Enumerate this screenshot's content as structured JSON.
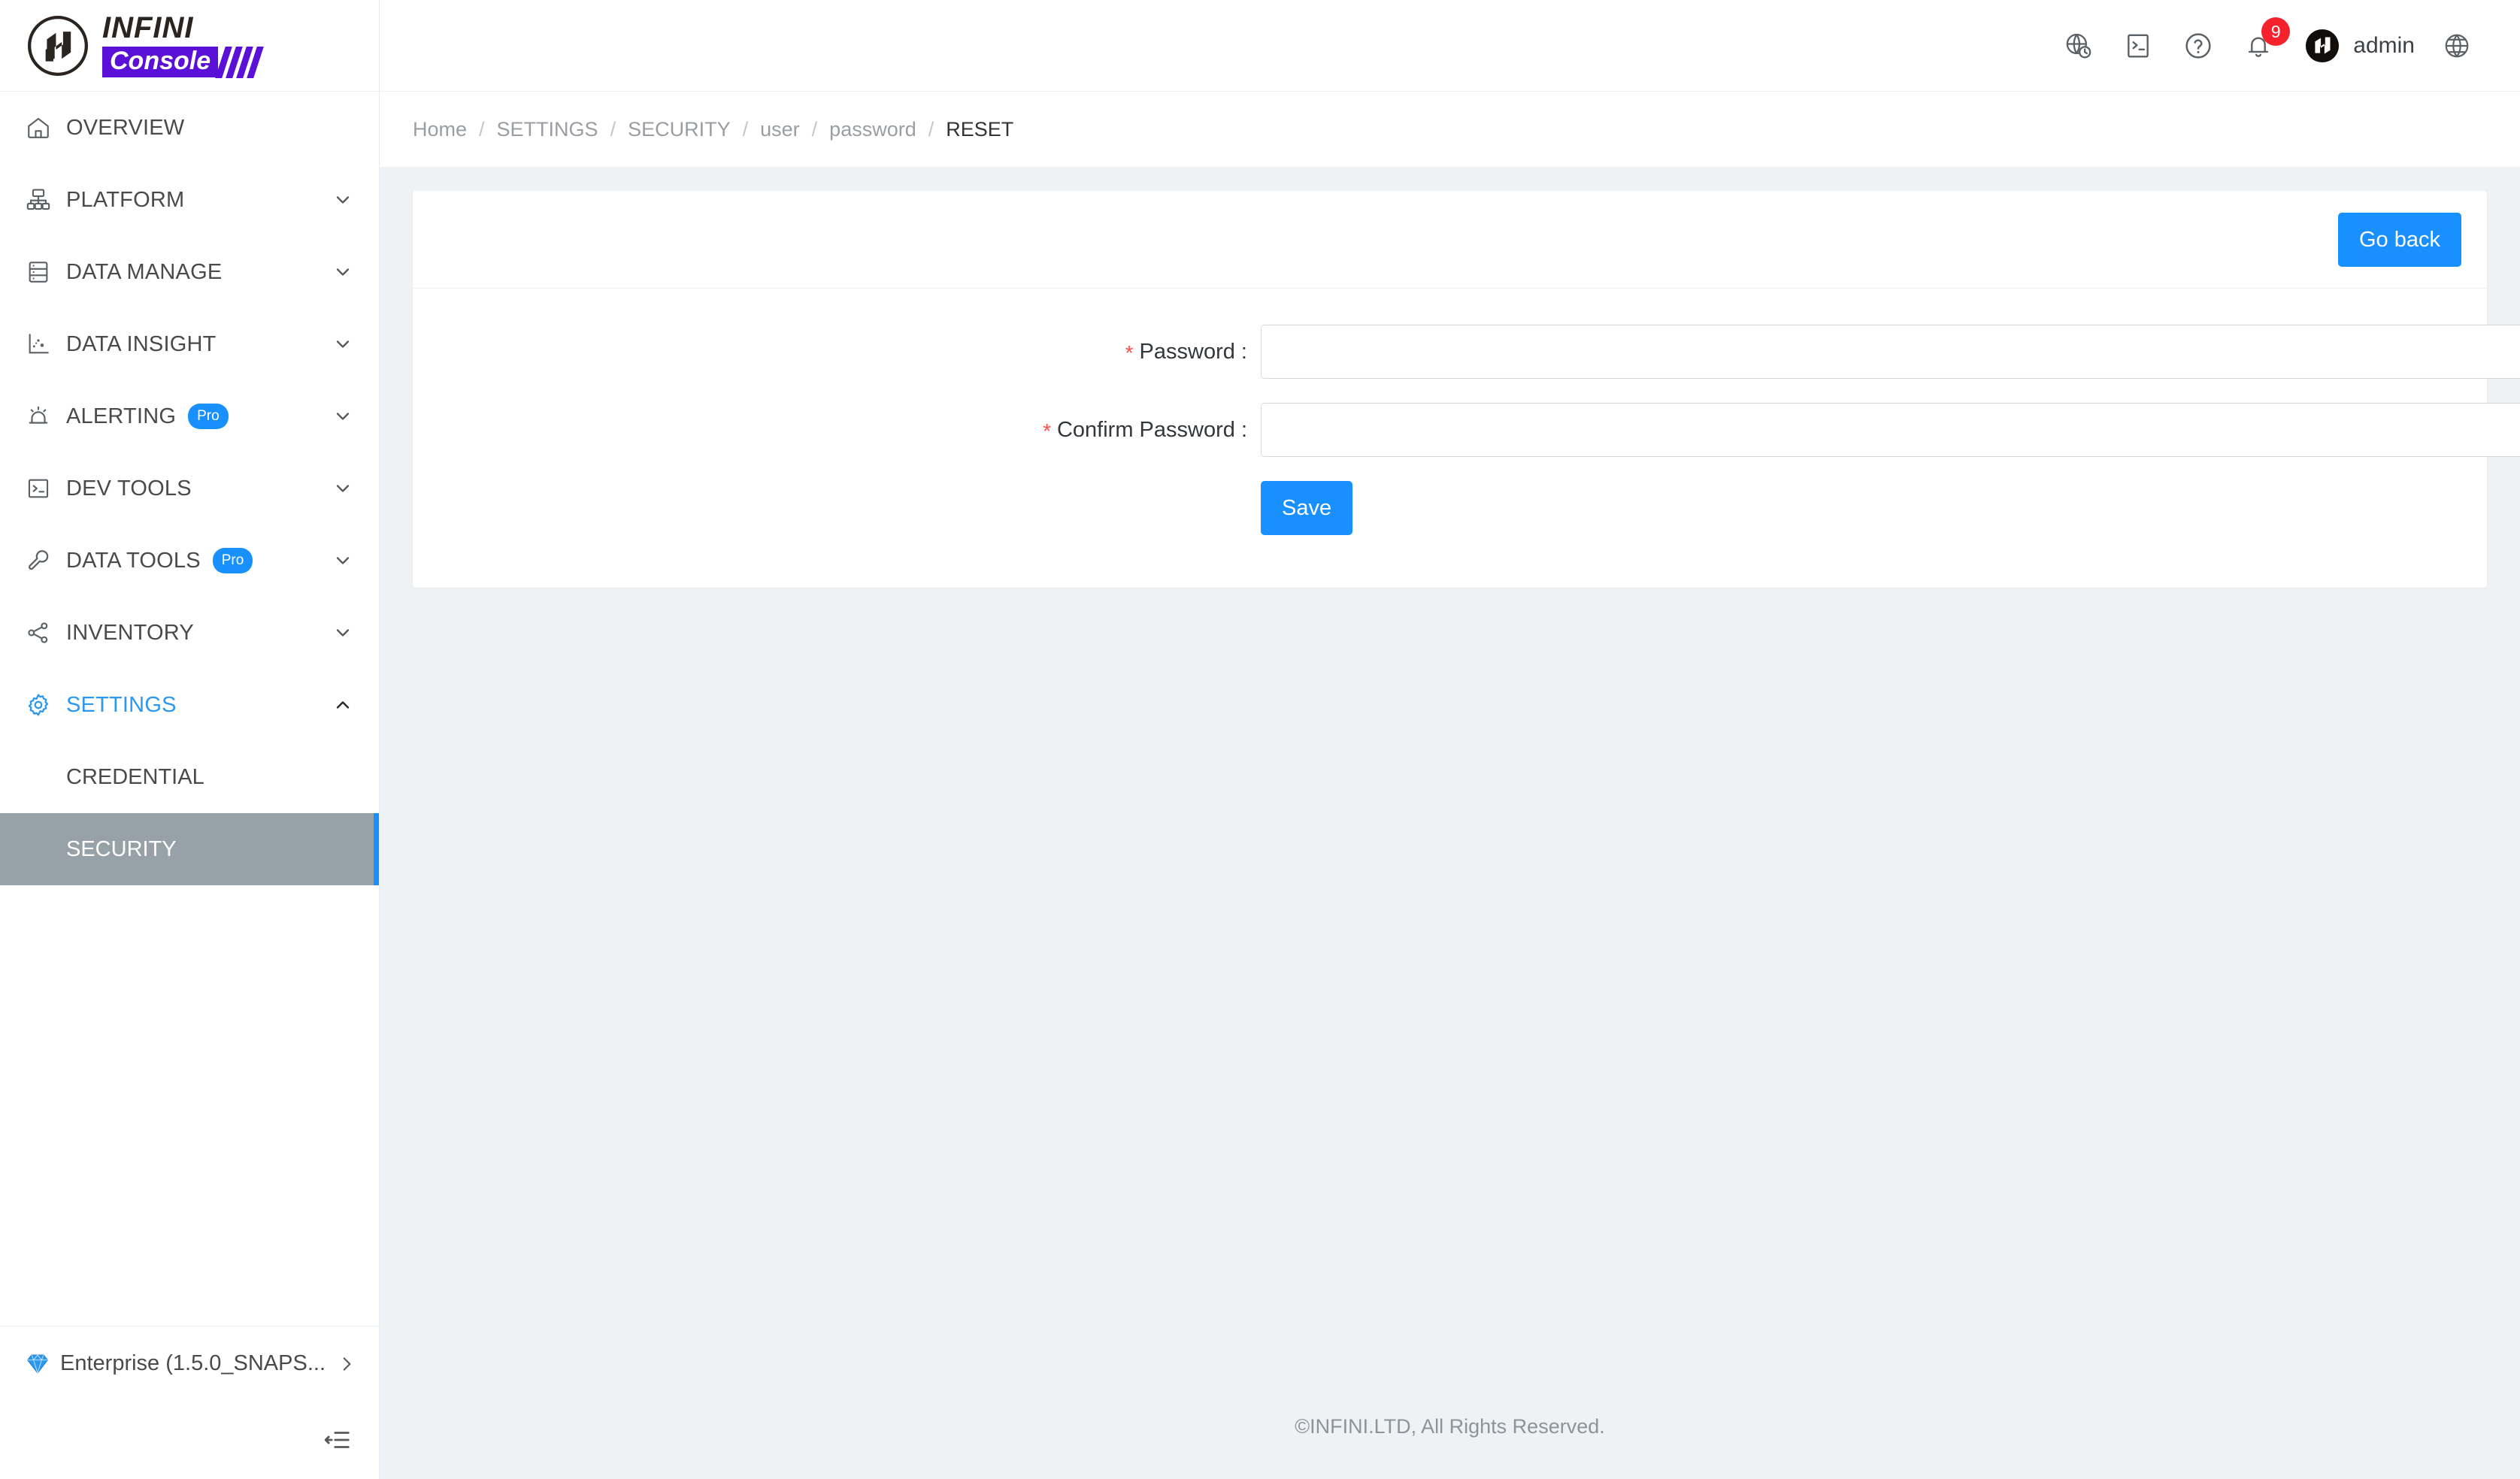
{
  "brand": {
    "name_top": "INFINI",
    "name_bottom": "Console",
    "logo_icon": "infini-n-logo-icon",
    "accent_purple": "#5b10d8"
  },
  "sidebar": {
    "items": [
      {
        "label": "OVERVIEW",
        "icon": "home-icon",
        "caret": "",
        "badge": ""
      },
      {
        "label": "PLATFORM",
        "icon": "sitemap-icon",
        "caret": "⌄",
        "badge": ""
      },
      {
        "label": "DATA MANAGE",
        "icon": "database-icon",
        "caret": "⌄",
        "badge": ""
      },
      {
        "label": "DATA INSIGHT",
        "icon": "scatter-chart-icon",
        "caret": "⌄",
        "badge": ""
      },
      {
        "label": "ALERTING",
        "icon": "alarm-icon",
        "caret": "⌄",
        "badge": "Pro"
      },
      {
        "label": "DEV TOOLS",
        "icon": "console-icon",
        "caret": "⌄",
        "badge": ""
      },
      {
        "label": "DATA TOOLS",
        "icon": "wrench-icon",
        "caret": "⌄",
        "badge": "Pro"
      },
      {
        "label": "INVENTORY",
        "icon": "share-nodes-icon",
        "caret": "⌄",
        "badge": ""
      },
      {
        "label": "SETTINGS",
        "icon": "gear-icon",
        "caret": "⌃",
        "badge": "",
        "active": true
      }
    ],
    "sub_items": [
      {
        "label": "CREDENTIAL",
        "selected": false
      },
      {
        "label": "SECURITY",
        "selected": true
      }
    ],
    "footer": {
      "icon": "diamond-icon",
      "label": "Enterprise (1.5.0_SNAPS...",
      "caret": "›"
    },
    "collapse_icon": "collapse-sidebar-icon",
    "active_accent": "#1890ff",
    "selected_bg": "#96a2a8"
  },
  "topbar": {
    "icons": [
      {
        "name": "globe-clock-icon"
      },
      {
        "name": "terminal-icon"
      },
      {
        "name": "help-circle-icon"
      },
      {
        "name": "bell-icon",
        "badge": "9"
      }
    ],
    "notification_count": "9",
    "notification_color": "#f5222d",
    "user": {
      "avatar": "infini-avatar-icon",
      "name": "admin"
    },
    "language_icon": "language-globe-icon"
  },
  "breadcrumb": {
    "separator": "/",
    "items": [
      {
        "label": "Home",
        "current": false
      },
      {
        "label": "SETTINGS",
        "current": false
      },
      {
        "label": "SECURITY",
        "current": false
      },
      {
        "label": "user",
        "current": false
      },
      {
        "label": "password",
        "current": false
      },
      {
        "label": "RESET",
        "current": true
      }
    ]
  },
  "card": {
    "go_back_label": "Go back",
    "form": {
      "required_mark": "*",
      "fields": [
        {
          "label": "Password :",
          "value": "",
          "placeholder": "",
          "type": "password",
          "required": true,
          "name": "password-field"
        },
        {
          "label": "Confirm Password :",
          "value": "",
          "placeholder": "",
          "type": "password",
          "required": true,
          "name": "confirm-password-field"
        }
      ],
      "submit_label": "Save"
    }
  },
  "footer": {
    "copyright": "©INFINI.LTD, All Rights Reserved."
  },
  "colors": {
    "primary": "#1890ff",
    "page_bg": "#eff2f5",
    "card_bg": "#ffffff",
    "required_red": "#ff4d4f"
  }
}
